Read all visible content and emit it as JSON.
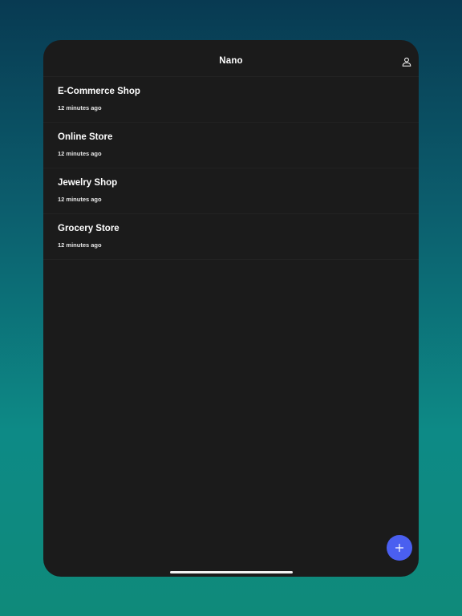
{
  "app": {
    "title": "Nano"
  },
  "header": {
    "profile_icon": "person-outline-icon"
  },
  "stores": [
    {
      "name": "E-Commerce Shop",
      "time": "12 minutes ago"
    },
    {
      "name": "Online Store",
      "time": "12 minutes ago"
    },
    {
      "name": "Jewelry Shop",
      "time": "12 minutes ago"
    },
    {
      "name": "Grocery Store",
      "time": "12 minutes ago"
    }
  ],
  "fab": {
    "icon": "plus-icon",
    "color": "#4a5ff0"
  },
  "colors": {
    "panel_background": "#1b1b1b",
    "accent": "#4a5ff0"
  }
}
